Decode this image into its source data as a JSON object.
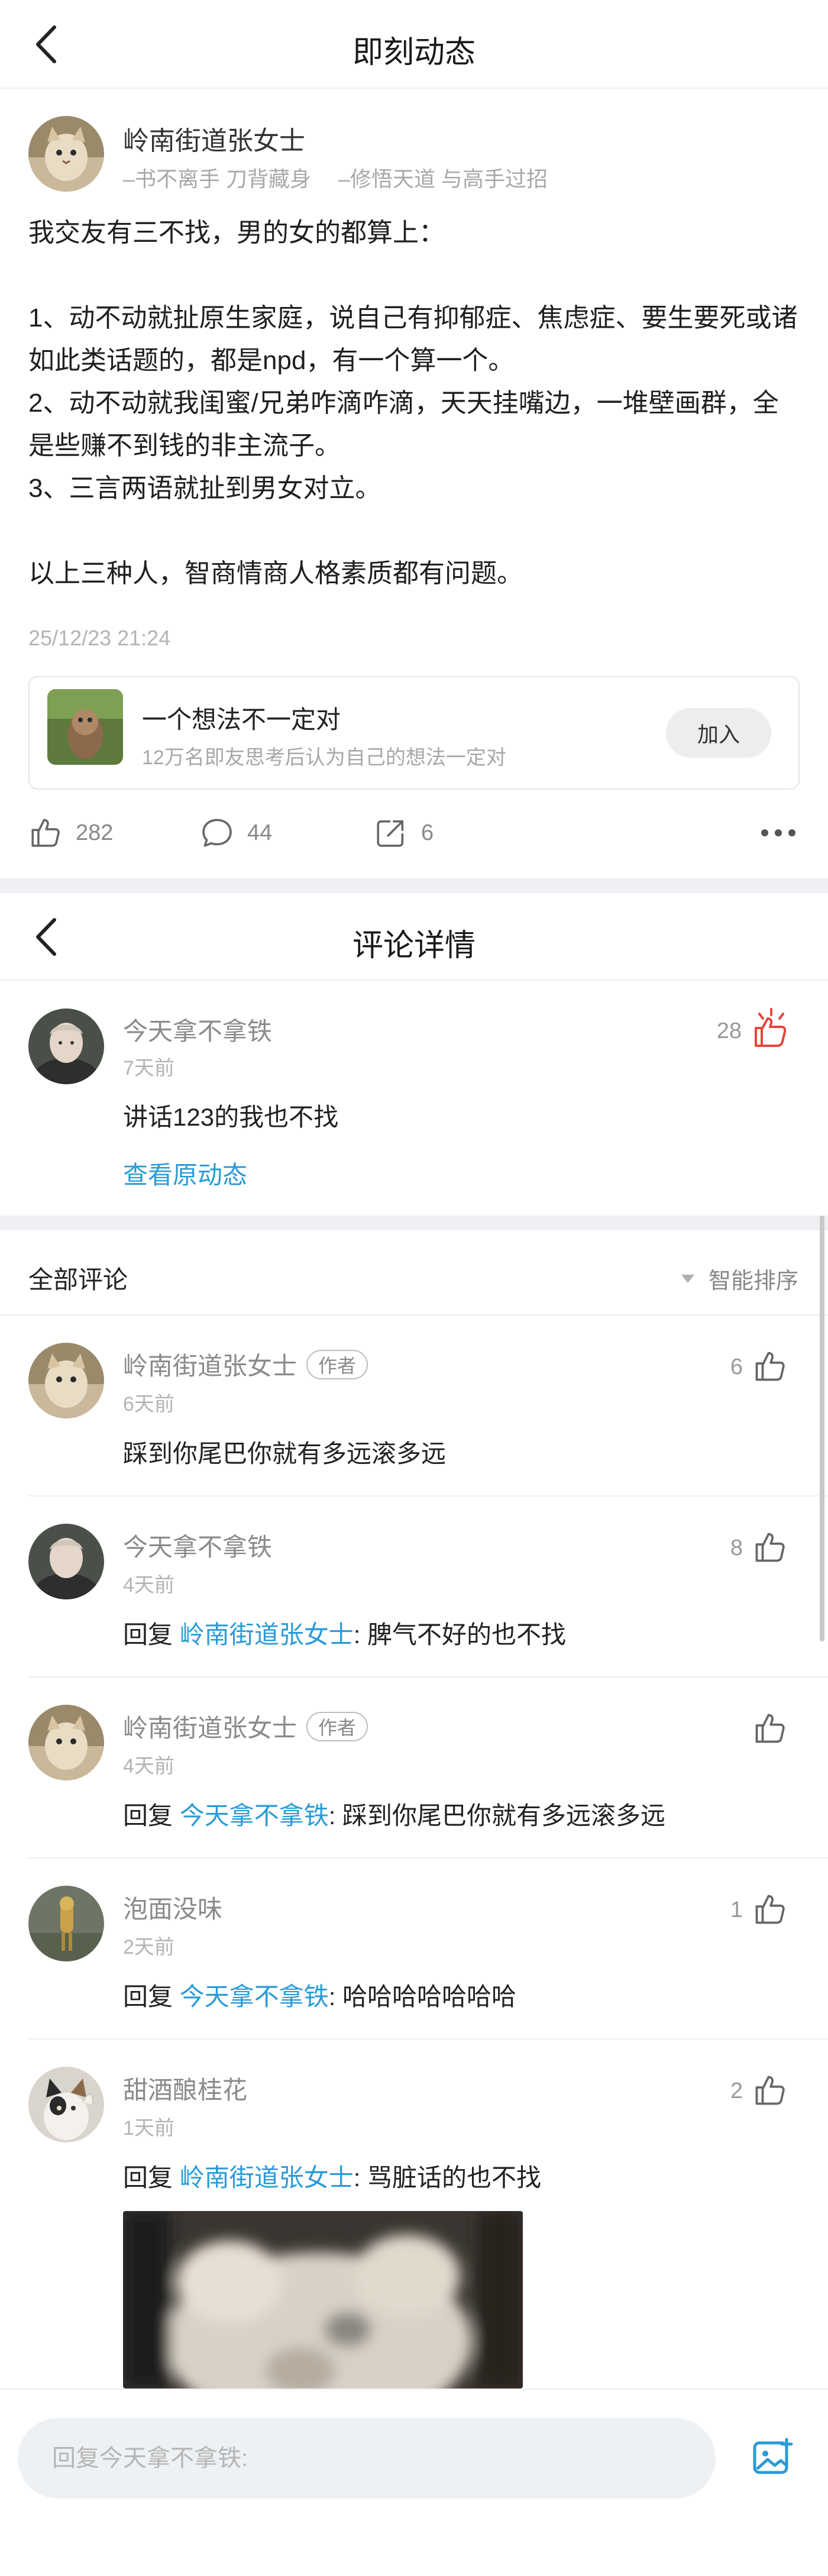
{
  "header": {
    "title": "即刻动态"
  },
  "post": {
    "author": "岭南街道张女士",
    "signature_1": "–书不离手 刀背藏身",
    "signature_2": "–修悟天道 与高手过招",
    "body": "我交友有三不找，男的女的都算上：\n\n1、动不动就扯原生家庭，说自己有抑郁症、焦虑症、要生要死或诸如此类话题的，都是npd，有一个算一个。\n2、动不动就我闺蜜/兄弟咋滴咋滴，天天挂嘴边，一堆壁画群，全是些赚不到钱的非主流子。\n3、三言两语就扯到男女对立。\n\n以上三种人，智商情商人格素质都有问题。",
    "time": "25/12/23 21:24",
    "group": {
      "name": "一个想法不一定对",
      "desc": "12万名即友思考后认为自己的想法一定对",
      "join_label": "加入"
    },
    "actions": {
      "likes": "282",
      "comments": "44",
      "shares": "6"
    }
  },
  "comment_detail": {
    "title": "评论详情",
    "main": {
      "name": "今天拿不拿铁",
      "time": "7天前",
      "text": "讲话123的我也不找",
      "likes": "28",
      "link": "查看原动态"
    }
  },
  "comments_section": {
    "title": "全部评论",
    "sort_label": "智能排序",
    "author_tag": "作者",
    "reply_word": "回复",
    "items": [
      {
        "name": "岭南街道张女士",
        "time": "6天前",
        "text": "踩到你尾巴你就有多远滚多远",
        "likes": "6",
        "reply_to": ""
      },
      {
        "name": "今天拿不拿铁",
        "time": "4天前",
        "text": ": 脾气不好的也不找",
        "likes": "8",
        "reply_to": "岭南街道张女士"
      },
      {
        "name": "岭南街道张女士",
        "time": "4天前",
        "text": ": 踩到你尾巴你就有多远滚多远",
        "likes": "",
        "reply_to": "今天拿不拿铁"
      },
      {
        "name": "泡面没味",
        "time": "2天前",
        "text": ": 哈哈哈哈哈哈哈",
        "likes": "1",
        "reply_to": "今天拿不拿铁"
      },
      {
        "name": "甜酒酿桂花",
        "time": "1天前",
        "text": ": 骂脏话的也不找",
        "likes": "2",
        "reply_to": "岭南街道张女士"
      }
    ]
  },
  "reply_bar": {
    "placeholder": "回复今天拿不拿铁:"
  },
  "colors": {
    "link_blue": "#2a9bd6",
    "liked_red": "#e8453c",
    "separator": "#eef0f3"
  }
}
